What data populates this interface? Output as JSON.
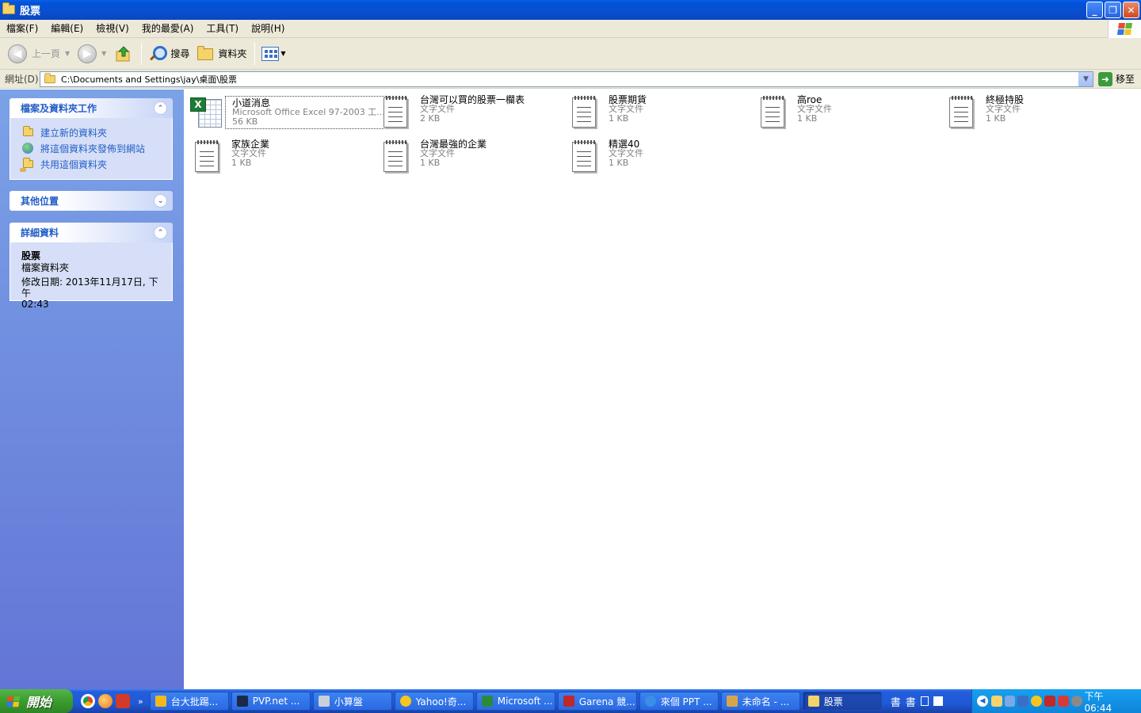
{
  "window": {
    "title": "股票"
  },
  "menu": [
    "檔案(F)",
    "編輯(E)",
    "檢視(V)",
    "我的最愛(A)",
    "工具(T)",
    "說明(H)"
  ],
  "toolbar": {
    "back_label": "上一頁",
    "search_label": "搜尋",
    "folders_label": "資料夾"
  },
  "address": {
    "label": "網址(D)",
    "path": "C:\\Documents and Settings\\jay\\桌面\\股票",
    "go_label": "移至"
  },
  "taskpane": {
    "file_tasks": {
      "title": "檔案及資料夾工作",
      "links": [
        "建立新的資料夾",
        "將這個資料夾發佈到網站",
        "共用這個資料夾"
      ]
    },
    "other_places": {
      "title": "其他位置"
    },
    "details": {
      "title": "詳細資料",
      "name": "股票",
      "type": "檔案資料夾",
      "modified_line1": "修改日期: 2013年11月17日, 下午",
      "modified_line2": "02:43"
    }
  },
  "files": [
    {
      "name": "小道消息",
      "type": "Microsoft Office Excel 97-2003 工...",
      "size": "56 KB",
      "kind": "excel"
    },
    {
      "name": "台灣可以買的股票一欄表",
      "type": "文字文件",
      "size": "2 KB",
      "kind": "text"
    },
    {
      "name": "股票期貨",
      "type": "文字文件",
      "size": "1 KB",
      "kind": "text"
    },
    {
      "name": "高roe",
      "type": "文字文件",
      "size": "1 KB",
      "kind": "text"
    },
    {
      "name": "終極持股",
      "type": "文字文件",
      "size": "1 KB",
      "kind": "text"
    },
    {
      "name": "家族企業",
      "type": "文字文件",
      "size": "1 KB",
      "kind": "text"
    },
    {
      "name": "台灣最強的企業",
      "type": "文字文件",
      "size": "1 KB",
      "kind": "text"
    },
    {
      "name": "精選40",
      "type": "文字文件",
      "size": "1 KB",
      "kind": "text"
    }
  ],
  "taskbar": {
    "start_label": "開始",
    "quicklaunch_more": "»",
    "tasks": [
      {
        "label": "台大批踢...",
        "icon_color": "#f2b81e"
      },
      {
        "label": "PVP.net ...",
        "icon_color": "#1c2a48"
      },
      {
        "label": "小算盤",
        "icon_color": "#c9cfd8"
      },
      {
        "label": "Yahoo!奇...",
        "icon_color": "#f6c51f"
      },
      {
        "label": "Microsoft ...",
        "icon_color": "#2c8a3a"
      },
      {
        "label": "Garena 競...",
        "icon_color": "#c0282a"
      },
      {
        "label": "來個 PPT ...",
        "icon_color": "#3a8ee6"
      },
      {
        "label": "未命名 - ...",
        "icon_color": "#d9a54a"
      },
      {
        "label": "股票",
        "icon_color": "#f5d36b",
        "active": true
      }
    ],
    "ime": [
      "書",
      "書"
    ],
    "clock": "下午 06:44"
  }
}
